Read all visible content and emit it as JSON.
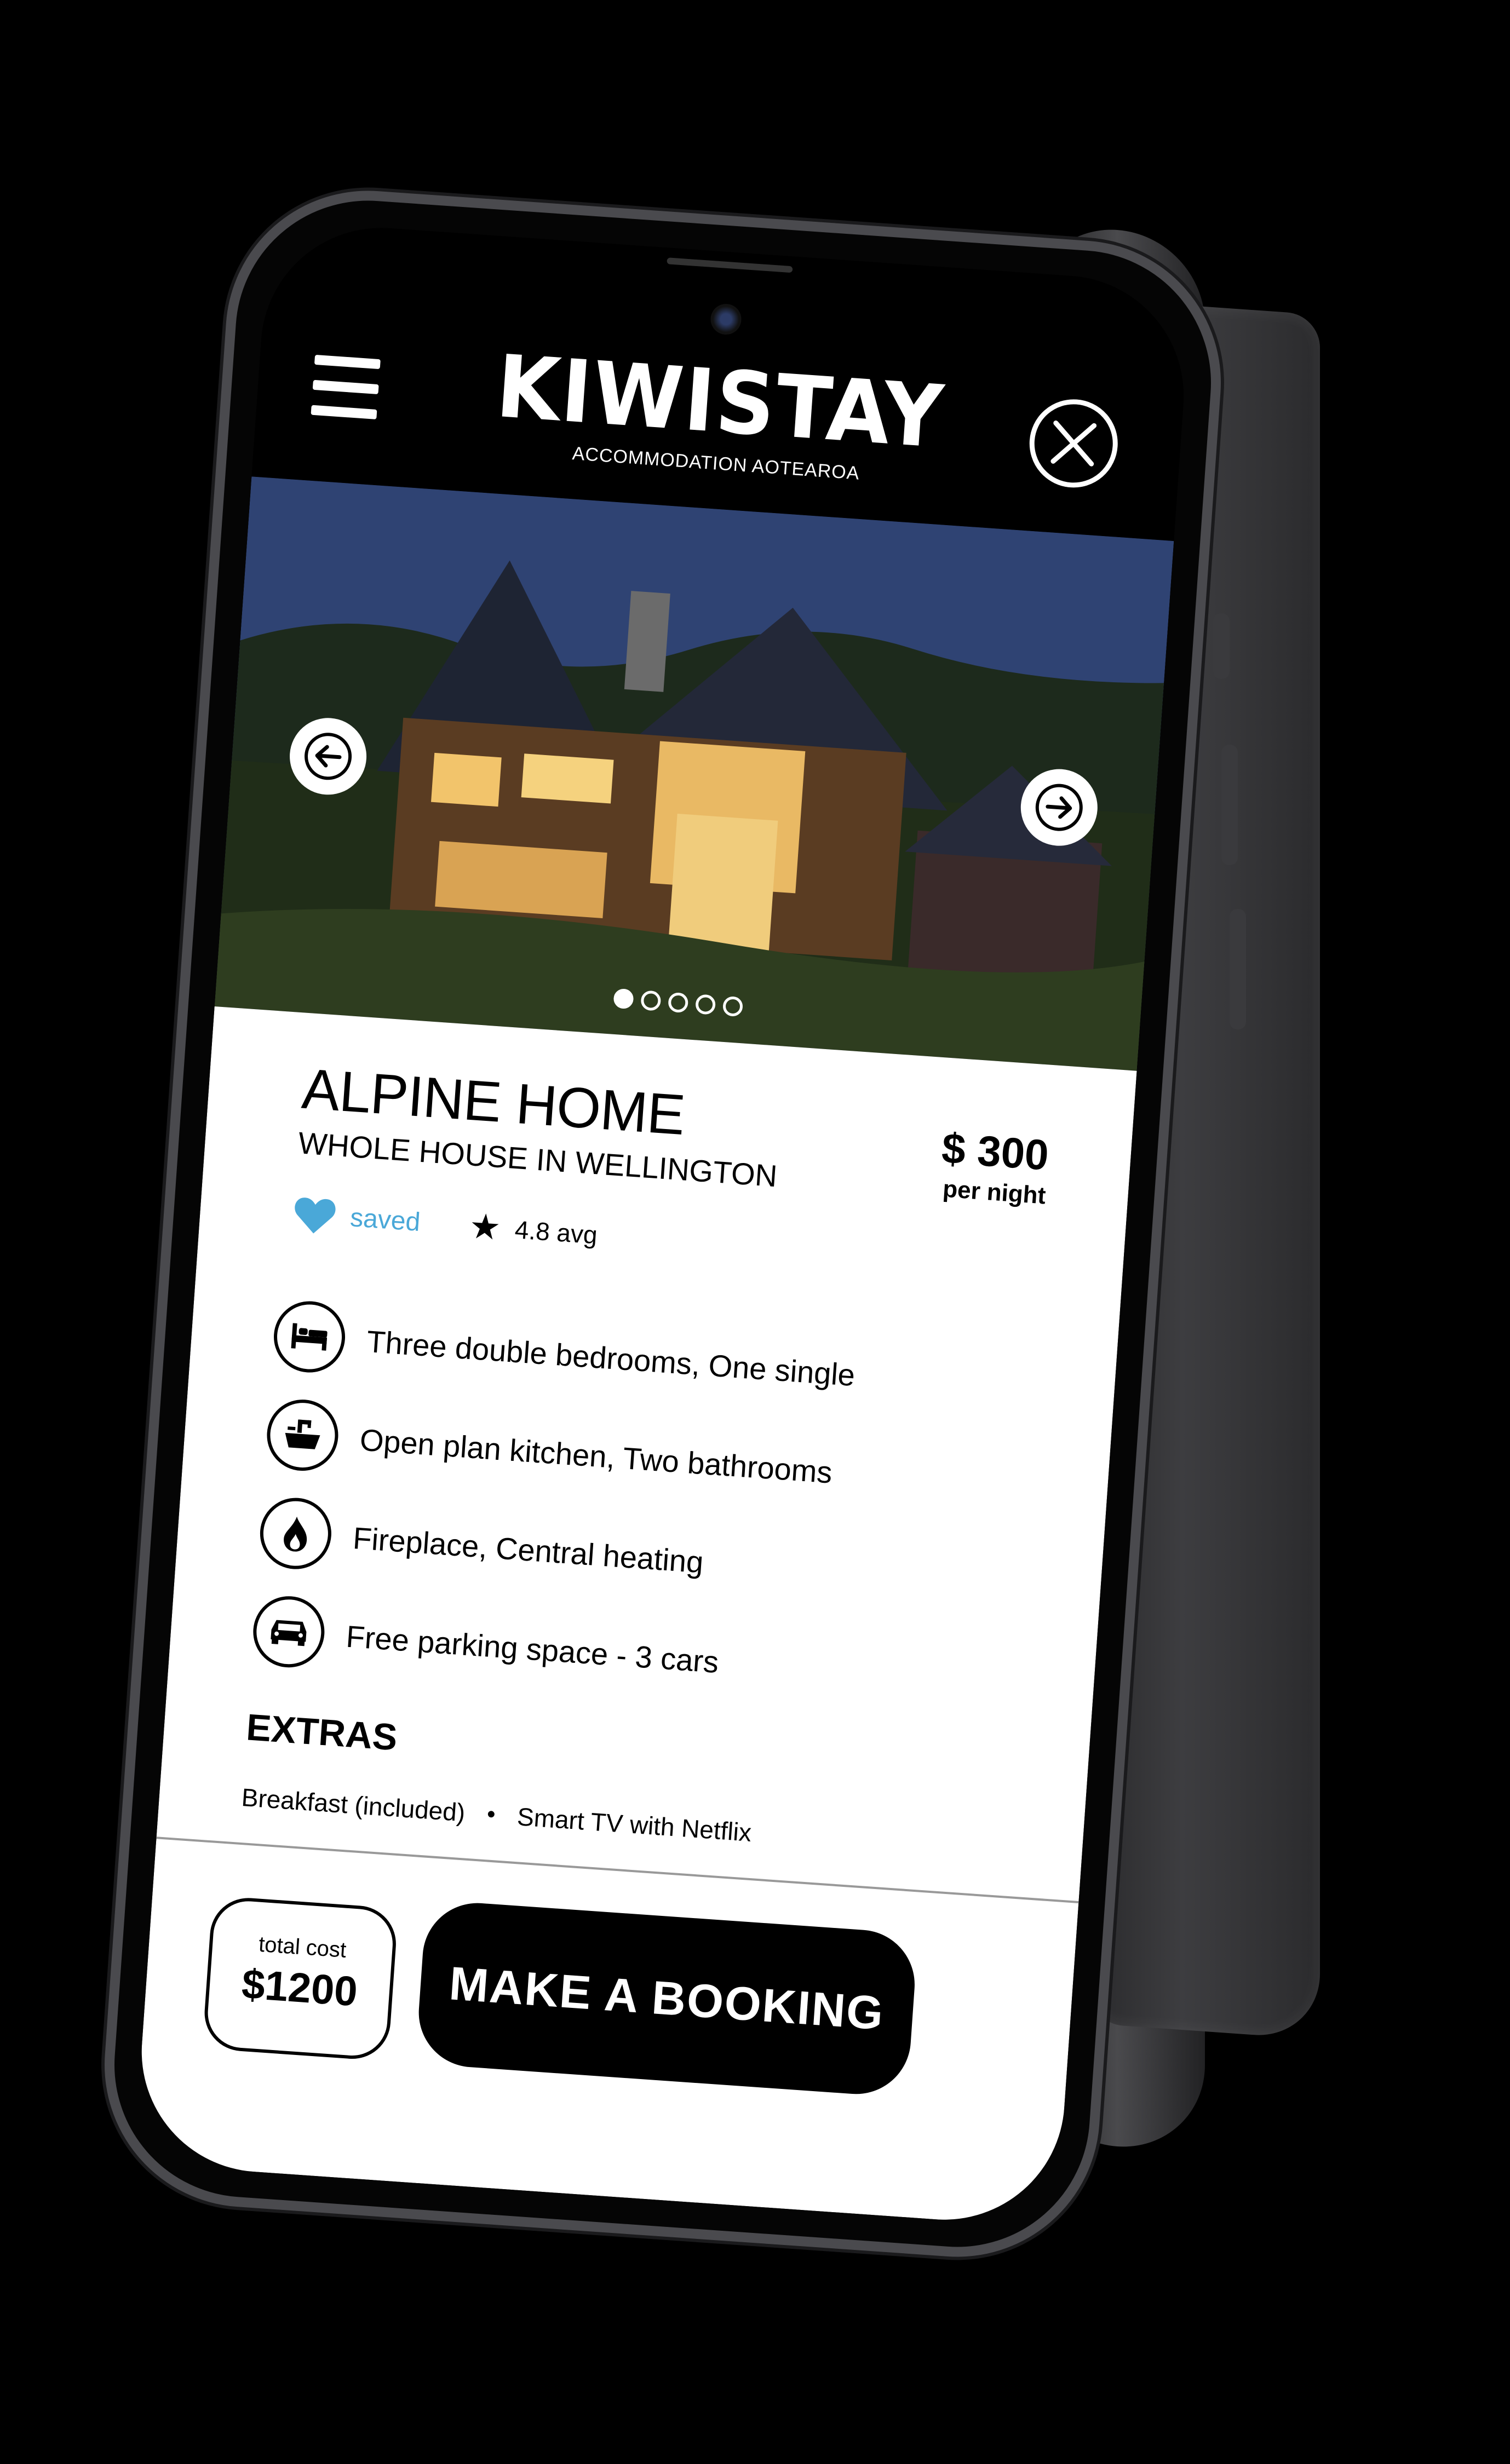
{
  "header": {
    "logo_text": "KIWISTAY",
    "logo_subtitle": "ACCOMMODATION AOTEAROA",
    "menu_icon": "hamburger-icon",
    "close_icon": "close-icon"
  },
  "gallery": {
    "current_index": 1,
    "total_images": 5,
    "prev_icon": "arrow-left-icon",
    "next_icon": "arrow-right-icon"
  },
  "listing": {
    "title": "ALPINE HOME",
    "subtitle": "WHOLE HOUSE IN WELLINGTON",
    "price": "$ 300",
    "price_unit": "per night",
    "saved_label": "saved",
    "rating": "4.8 avg",
    "star_symbol": "★"
  },
  "features": [
    {
      "icon": "bed-icon",
      "text": "Three double bedrooms, One single"
    },
    {
      "icon": "sink-icon",
      "text": "Open plan kitchen, Two bathrooms"
    },
    {
      "icon": "flame-icon",
      "text": "Fireplace, Central heating"
    },
    {
      "icon": "car-icon",
      "text": "Free parking space - 3 cars"
    }
  ],
  "extras": {
    "heading": "EXTRAS",
    "items": [
      "Breakfast (included)",
      "Smart TV with Netflix"
    ],
    "separator": "•"
  },
  "footer": {
    "total_label": "total cost",
    "total_value": "$1200",
    "book_label": "MAKE A BOOKING"
  },
  "colors": {
    "accent_saved": "#4aa8d8",
    "background": "#000000",
    "panel": "#ffffff"
  }
}
